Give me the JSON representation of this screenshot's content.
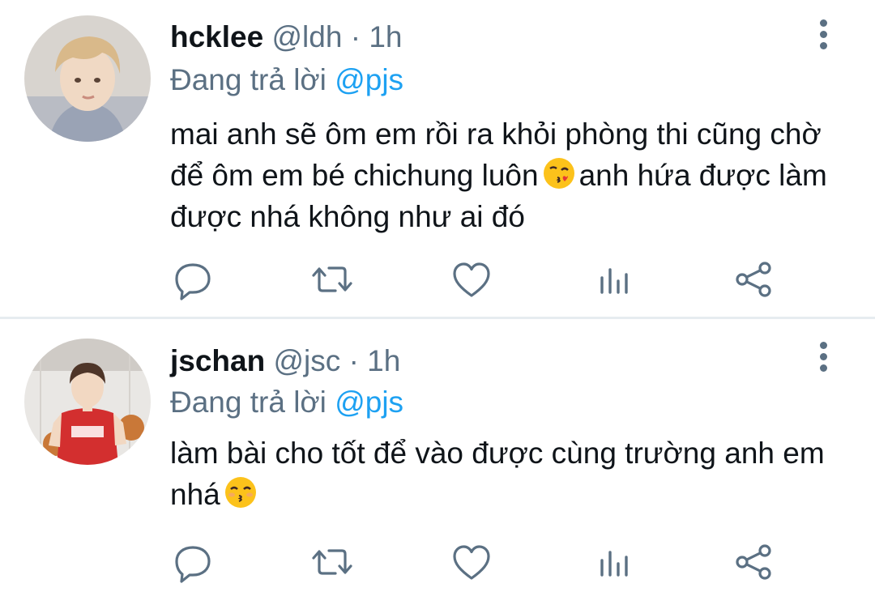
{
  "tweets": [
    {
      "name": "hcklee",
      "handle": "@ldh",
      "separator": "·",
      "time": "1h",
      "replying_prefix": "Đang trả lời",
      "replying_to": "@pjs",
      "text_1": "mai anh sẽ ôm em rồi ra khỏi phòng thi cũng chờ để ôm em bé chichung luôn",
      "text_2": "anh hứa được làm được nhá không như ai đó"
    },
    {
      "name": "jschan",
      "handle": "@jsc",
      "separator": "·",
      "time": "1h",
      "replying_prefix": "Đang trả lời",
      "replying_to": "@pjs",
      "text_1": "làm bài cho tốt để vào được cùng trường anh em nhá"
    }
  ],
  "icons": {
    "reply": "reply-icon",
    "retweet": "retweet-icon",
    "like": "heart-icon",
    "stats": "analytics-icon",
    "share": "share-icon",
    "more": "more-vertical-icon"
  },
  "colors": {
    "text": "#0f1419",
    "secondary": "#5b7083",
    "link": "#1da1f2",
    "divider": "#e6ecf0"
  }
}
